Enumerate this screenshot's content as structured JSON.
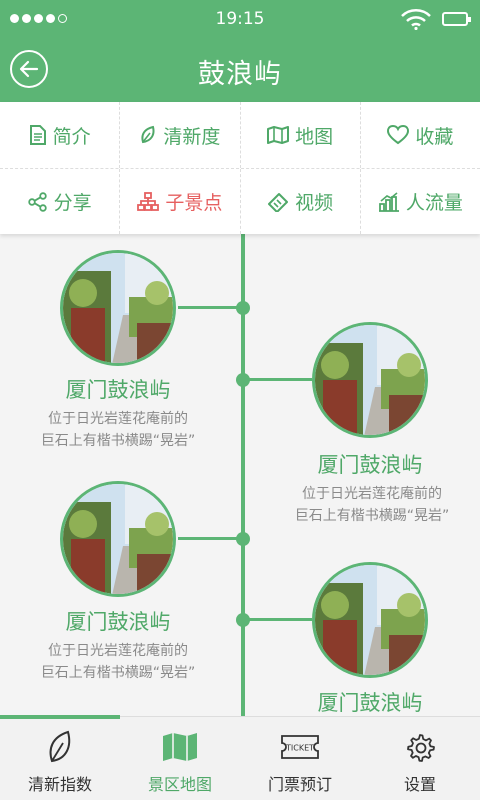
{
  "status": {
    "time": "19:15"
  },
  "header": {
    "title": "鼓浪屿"
  },
  "menu": [
    {
      "label": "简介",
      "icon": "document-icon"
    },
    {
      "label": "清新度",
      "icon": "leaf-icon"
    },
    {
      "label": "地图",
      "icon": "map-icon"
    },
    {
      "label": "收藏",
      "icon": "heart-icon"
    },
    {
      "label": "分享",
      "icon": "share-icon"
    },
    {
      "label": "子景点",
      "icon": "sitemap-icon",
      "active": true
    },
    {
      "label": "视频",
      "icon": "ticket-tag-icon"
    },
    {
      "label": "人流量",
      "icon": "chart-icon"
    }
  ],
  "spots": [
    {
      "title": "厦门鼓浪屿",
      "desc1": "位于日光岩莲花庵前的",
      "desc2": "巨石上有楷书横踢“晃岩”"
    },
    {
      "title": "厦门鼓浪屿",
      "desc1": "位于日光岩莲花庵前的",
      "desc2": "巨石上有楷书横踢“晃岩”"
    },
    {
      "title": "厦门鼓浪屿",
      "desc1": "位于日光岩莲花庵前的",
      "desc2": "巨石上有楷书横踢“晃岩”"
    },
    {
      "title": "厦门鼓浪屿",
      "desc1": "",
      "desc2": ""
    }
  ],
  "tabs": [
    {
      "label": "清新指数",
      "icon": "leaf-outline-icon"
    },
    {
      "label": "景区地图",
      "icon": "map-filled-icon",
      "active": true
    },
    {
      "label": "门票预订",
      "icon": "ticket-icon",
      "badge": "TICKET"
    },
    {
      "label": "设置",
      "icon": "gear-icon"
    }
  ],
  "colors": {
    "primary": "#5cb575",
    "active_menu": "#e66060"
  }
}
